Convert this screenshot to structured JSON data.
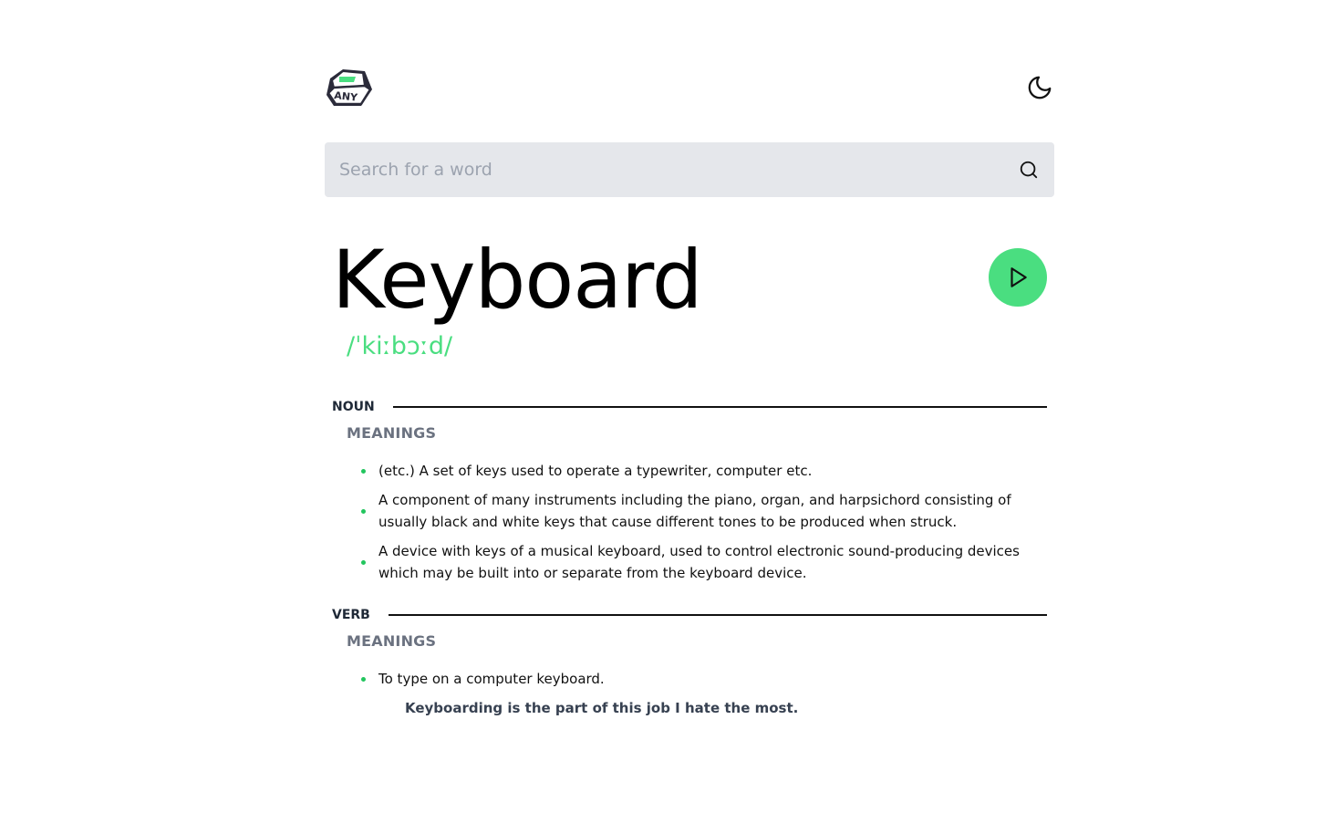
{
  "header": {
    "logo_text": "ANY",
    "theme_toggle_icon": "moon-icon"
  },
  "search": {
    "placeholder": "Search for a word",
    "value": "",
    "icon": "search-icon"
  },
  "entry": {
    "word": "Keyboard",
    "phonetic": "/ˈkiːbɔːd/",
    "play_icon": "play-icon"
  },
  "sections": {
    "noun": {
      "label": "NOUN",
      "meanings_label": "MEANINGS",
      "definitions": [
        "(etc.) A set of keys used to operate a typewriter, computer etc.",
        "A component of many instruments including the piano, organ, and harpsichord consisting of usually black and white keys that cause different tones to be produced when struck.",
        "A device with keys of a musical keyboard, used to control electronic sound-producing devices which may be built into or separate from the keyboard device."
      ]
    },
    "verb": {
      "label": "VERB",
      "meanings_label": "MEANINGS",
      "definitions": [
        "To type on a computer keyboard."
      ],
      "example": "Keyboarding is the part of this job I hate the most."
    }
  },
  "colors": {
    "accent": "#4ade80",
    "bullet": "#22c55e",
    "search_bg": "#e5e7eb",
    "muted": "#6b7280"
  }
}
